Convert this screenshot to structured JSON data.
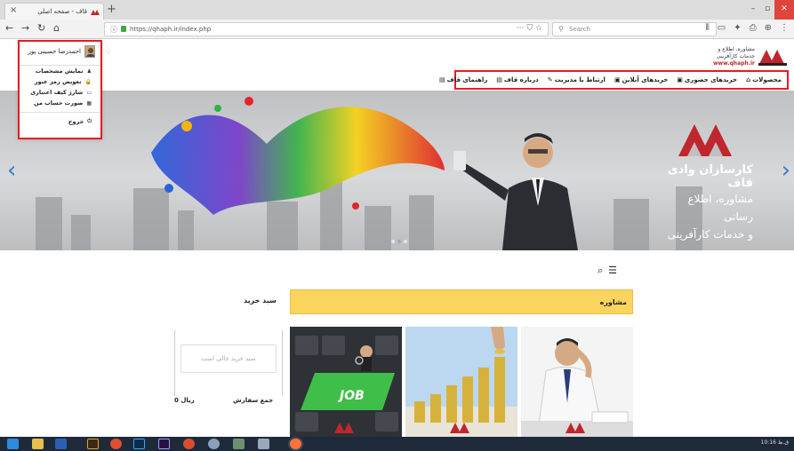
{
  "browser": {
    "tab_title": "قاف - صفحه اصلی",
    "tab_close": "×",
    "new_tab": "+",
    "url": "https://qhaph.ir/index.php",
    "url_actions": "··· ⛉ ☆",
    "search_placeholder": "Search",
    "window_controls": [
      "–",
      "▫",
      "✕"
    ]
  },
  "site": {
    "logo_lines": [
      "مشاوره، اطلاع و",
      "خدمات کارآفرینی",
      "www.qhaph.ir"
    ],
    "bell_icon": "♢"
  },
  "main_nav": {
    "items": [
      {
        "label": "محصولات",
        "icon": "home-icon",
        "glyph": "⌂"
      },
      {
        "label": "خریدهای حضوری",
        "icon": "bag-icon",
        "glyph": "▣"
      },
      {
        "label": "خریدهای آنلاین",
        "icon": "bag-icon",
        "glyph": "▣"
      },
      {
        "label": "ارتباط با مدیریت",
        "icon": "send-icon",
        "glyph": "✎"
      },
      {
        "label": "درباره قاف",
        "icon": "doc-icon",
        "glyph": "▤"
      },
      {
        "label": "راهنمای قاف",
        "icon": "doc-icon",
        "glyph": "▤"
      }
    ]
  },
  "user_menu": {
    "user_name": "احمدرضا حسینی پور",
    "items": [
      {
        "label": "نمایش مشخصات",
        "glyph": "♟"
      },
      {
        "label": "تعویض رمز عبور",
        "glyph": "🔒"
      },
      {
        "label": "شارژ کیف اعتباری",
        "glyph": "▭"
      },
      {
        "label": "صورت حساب من",
        "glyph": "▦"
      }
    ],
    "logout_label": "خروج",
    "logout_glyph": "⏻"
  },
  "slider": {
    "brand_name": "کارسازان وادی قاف",
    "tagline_1": "مشاوره، اطلاع رسانی",
    "tagline_2": "و خدمات کارآفرینی",
    "prev": "‹",
    "next": "›"
  },
  "content": {
    "view_search_glyph": "⌕",
    "view_list_glyph": "☰",
    "cart_title": "سبد خرید",
    "category_title": "مشاوره",
    "cart_empty": "سبد خرید خالی است",
    "cart_total_label": "جمع سفارش",
    "cart_total_value": "0 ریال",
    "card_job_text": "JOB"
  },
  "taskbar": {
    "tray": "10:16 ق.ظ"
  },
  "colors": {
    "accent_red": "#e51b23",
    "category_yellow": "#fbd45e",
    "slider_arrow": "#2f7fc9",
    "logo_red": "#c0262d"
  }
}
